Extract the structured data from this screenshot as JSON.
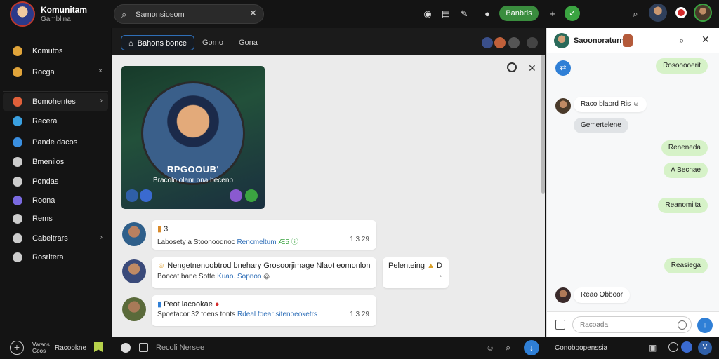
{
  "app": {
    "title": "Komunitam",
    "subtitle": "Gamblina"
  },
  "search": {
    "placeholder": "Samonsiosom"
  },
  "topbar": {
    "button_label": "Banbris",
    "plus": "+"
  },
  "sidebar": {
    "items": [
      {
        "label": "Komutos",
        "icon": "star-icon",
        "color": "#e0a43a"
      },
      {
        "label": "Rocga",
        "icon": "folder-icon",
        "color": "#e0a43a",
        "chevron": "×"
      },
      {
        "label": "Bomohentes",
        "icon": "fire-icon",
        "color": "#e0603a",
        "chevron": "›"
      },
      {
        "label": "Recera",
        "icon": "shield-icon",
        "color": "#3aa0e0"
      },
      {
        "label": "Pande dacos",
        "icon": "link-icon",
        "color": "#3a8fe0"
      },
      {
        "label": "Bmenilos",
        "icon": "list-icon",
        "color": "#cccccc"
      },
      {
        "label": "Pondas",
        "icon": "globe-icon",
        "color": "#cccccc"
      },
      {
        "label": "Roona",
        "icon": "bolt-icon",
        "color": "#7a6ae0"
      },
      {
        "label": "Rems",
        "icon": "grid-icon",
        "color": "#cccccc"
      },
      {
        "label": "Cabeitrars",
        "icon": "clock-icon",
        "color": "#cccccc",
        "chevron": "›"
      },
      {
        "label": "Rosritera",
        "icon": "chat-icon",
        "color": "#cccccc"
      }
    ]
  },
  "main": {
    "tabs": [
      "Bahons bonce",
      "Gomo",
      "Gona"
    ],
    "media": {
      "title": "RPGOOUB'",
      "caption": "Bracolo olanr ona becenb"
    },
    "posts": [
      {
        "title": "3",
        "text": "Labosety a Stoonoodnoc",
        "link": "Rencmeltum",
        "link2": "Æ5 ⓘ",
        "meta": "1 3 29"
      },
      {
        "title": "Nengetnenoobtrod bnehary Grosoorjimage Nlaot eomonlon",
        "text": "Boocat bane Sotte",
        "link": "Kuao. Sopnoo",
        "link2": "◎",
        "meta": ""
      },
      {
        "title": "Peot lacookae",
        "text": "Spoetacor 32 toens tonts",
        "link": "Rdeal foear sitenoeoketrs",
        "link2": "",
        "meta": "1 3 29"
      }
    ],
    "side_note": {
      "title": "Pelenteing",
      "glyph": "D",
      "sub": "◦"
    }
  },
  "bottombar": {
    "left_text": "Varans\nGoos",
    "label": "Racookne",
    "placeholder": "Recoli Nersee"
  },
  "chat": {
    "name": "Saoonoraturn",
    "messages": [
      {
        "type": "out",
        "text": "Rosooooerit"
      },
      {
        "type": "in",
        "text": "Raco blaord Ris ☺"
      },
      {
        "type": "sys",
        "text": "Gemertelene"
      },
      {
        "type": "out",
        "text": "Reneneda"
      },
      {
        "type": "out",
        "text": "A Becnae"
      },
      {
        "type": "out",
        "text": "Reanomiita"
      },
      {
        "type": "out",
        "text": "Reasiega"
      },
      {
        "type": "in",
        "text": "Reao Obboor"
      }
    ],
    "input_placeholder": "Racoada",
    "footer_label": "Conoboopenssia"
  }
}
